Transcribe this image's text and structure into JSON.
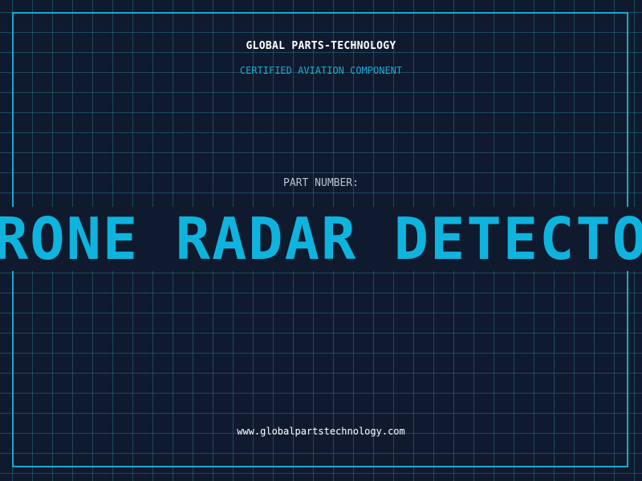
{
  "header": {
    "company": "GLOBAL PARTS-TECHNOLOGY",
    "tagline": "CERTIFIED AVIATION COMPONENT"
  },
  "part": {
    "label": "PART NUMBER:",
    "value": "DRONE RADAR DETECTOR"
  },
  "footer": {
    "website": "www.globalpartstechnology.com"
  },
  "colors": {
    "background": "#101a2e",
    "grid": "#28828f",
    "frame": "#1aa9cc",
    "accent": "#0eb4dd",
    "tagline": "#1fa9d4",
    "label": "#b8c4d4",
    "text": "#ffffff"
  }
}
